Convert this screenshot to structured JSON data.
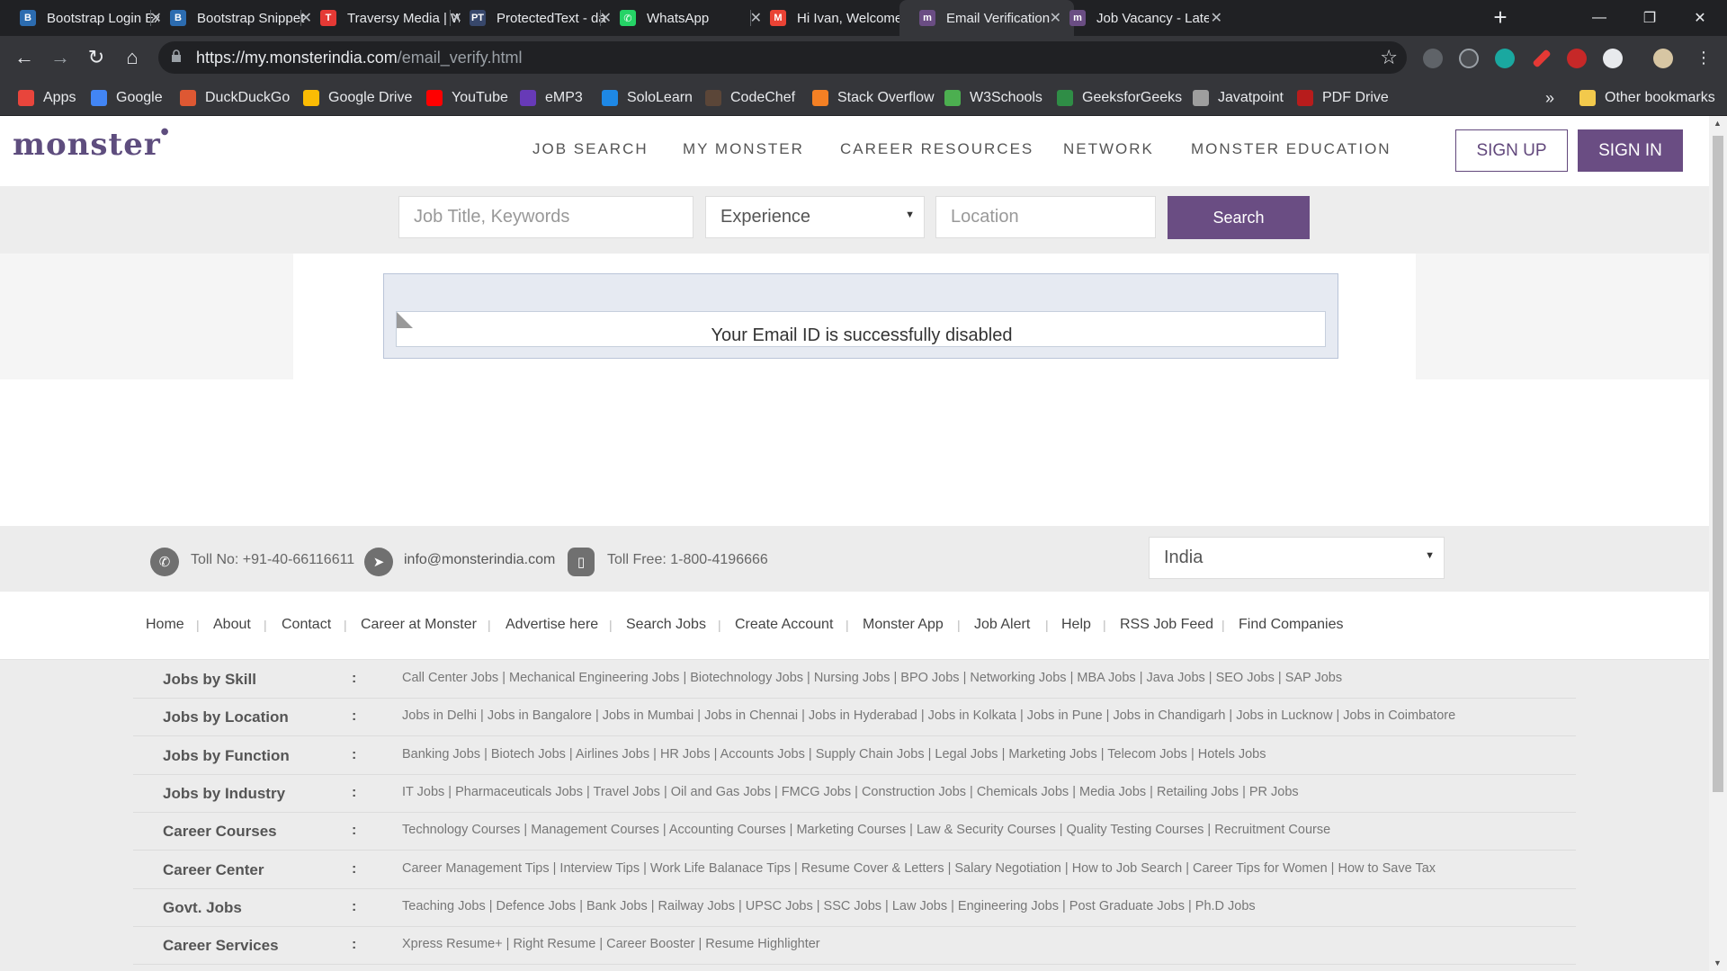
{
  "browser": {
    "tabs": [
      {
        "label": "Bootstrap Login Ex",
        "icon": "bootstrap-icon",
        "color": "#2c6cb0",
        "glyph": "B"
      },
      {
        "label": "Bootstrap Snippet",
        "icon": "bootstrap-icon",
        "color": "#2c6cb0",
        "glyph": "B"
      },
      {
        "label": "Traversy Media | W",
        "icon": "traversy-icon",
        "color": "#e53935",
        "glyph": "T"
      },
      {
        "label": "ProtectedText - da",
        "icon": "protectedtext-icon",
        "color": "#37476b",
        "glyph": "PT"
      },
      {
        "label": "WhatsApp",
        "icon": "whatsapp-icon",
        "color": "#25d366",
        "glyph": "✆"
      },
      {
        "label": "Hi Ivan, Welcome t",
        "icon": "gmail-icon",
        "color": "#ea4335",
        "glyph": "M"
      },
      {
        "label": "Email Verification",
        "icon": "monster-icon",
        "color": "#6a4d83",
        "glyph": "m"
      },
      {
        "label": "Job Vacancy - Late",
        "icon": "monster-icon",
        "color": "#6a4d83",
        "glyph": "m"
      }
    ],
    "active_tab_index": 6,
    "url_base": "https://my.monsterindia.com",
    "url_path": "/email_verify.html",
    "bookmarks": [
      {
        "label": "Apps",
        "icon": "apps-grid-icon",
        "color": "#e8453c"
      },
      {
        "label": "Google",
        "icon": "google-icon",
        "color": "#4285f4"
      },
      {
        "label": "DuckDuckGo",
        "icon": "duckduckgo-icon",
        "color": "#de5833"
      },
      {
        "label": "Google Drive",
        "icon": "google-drive-icon",
        "color": "#fbbc04"
      },
      {
        "label": "YouTube",
        "icon": "youtube-icon",
        "color": "#ff0000"
      },
      {
        "label": "eMP3",
        "icon": "emp3-icon",
        "color": "#673ab7"
      },
      {
        "label": "SoloLearn",
        "icon": "sololearn-icon",
        "color": "#1e88e5"
      },
      {
        "label": "CodeChef",
        "icon": "codechef-icon",
        "color": "#5b4638"
      },
      {
        "label": "Stack Overflow",
        "icon": "stackoverflow-icon",
        "color": "#f48024"
      },
      {
        "label": "W3Schools",
        "icon": "w3schools-icon",
        "color": "#4caf50"
      },
      {
        "label": "GeeksforGeeks",
        "icon": "geeksforgeeks-icon",
        "color": "#2f8d46"
      },
      {
        "label": "Javatpoint",
        "icon": "javatpoint-icon",
        "color": "#9e9e9e"
      },
      {
        "label": "PDF Drive",
        "icon": "pdfdrive-icon",
        "color": "#b71c1c"
      }
    ],
    "bookmarks_overflow": "»",
    "other_bookmarks": "Other bookmarks"
  },
  "site": {
    "logo": "monster",
    "nav": [
      "JOB SEARCH",
      "MY MONSTER",
      "CAREER RESOURCES",
      "NETWORK",
      "MONSTER EDUCATION"
    ],
    "signup": "SIGN UP",
    "signin": "SIGN IN",
    "brand_color": "#6a4d83"
  },
  "search": {
    "keywords_placeholder": "Job Title, Keywords",
    "experience_value": "Experience",
    "location_placeholder": "Location",
    "button": "Search"
  },
  "message": {
    "text": "Your Email ID is successfully disabled"
  },
  "contact": {
    "toll_no": "Toll No: +91-40-66116611",
    "email": "info@monsterindia.com",
    "toll_free": "Toll Free: 1-800-4196666",
    "country": "India"
  },
  "footer_links": [
    "Home",
    "About",
    "Contact",
    "Career at Monster",
    "Advertise here",
    "Search Jobs",
    "Create Account",
    "Monster App",
    "Job Alert",
    "Help",
    "RSS Job Feed",
    "Find Companies"
  ],
  "seo_rows": [
    {
      "head": "Jobs by Skill",
      "links": "Call Center Jobs | Mechanical Engineering Jobs | Biotechnology Jobs | Nursing Jobs | BPO Jobs | Networking Jobs | MBA Jobs | Java Jobs | SEO Jobs | SAP Jobs"
    },
    {
      "head": "Jobs by Location",
      "links": "Jobs in Delhi | Jobs in Bangalore | Jobs in Mumbai | Jobs in Chennai | Jobs in Hyderabad | Jobs in Kolkata | Jobs in Pune | Jobs in Chandigarh | Jobs in Lucknow | Jobs in Coimbatore"
    },
    {
      "head": "Jobs by Function",
      "links": "Banking Jobs | Biotech Jobs | Airlines Jobs | HR Jobs | Accounts Jobs | Supply Chain Jobs | Legal Jobs | Marketing Jobs | Telecom Jobs | Hotels Jobs"
    },
    {
      "head": "Jobs by Industry",
      "links": "IT Jobs | Pharmaceuticals Jobs | Travel Jobs | Oil and Gas Jobs | FMCG Jobs | Construction Jobs | Chemicals Jobs | Media Jobs | Retailing Jobs | PR Jobs"
    },
    {
      "head": "Career Courses",
      "links": "Technology Courses | Management Courses | Accounting Courses | Marketing Courses | Law & Security Courses | Quality Testing Courses | Recruitment Course"
    },
    {
      "head": "Career Center",
      "links": "Career Management Tips | Interview Tips | Work Life Balanace Tips | Resume Cover & Letters | Salary Negotiation | How to Job Search | Career Tips for Women | How to Save Tax"
    },
    {
      "head": "Govt. Jobs",
      "links": "Teaching Jobs | Defence Jobs | Bank Jobs | Railway Jobs | UPSC Jobs | SSC Jobs | Law Jobs | Engineering Jobs | Post Graduate Jobs | Ph.D Jobs"
    },
    {
      "head": "Career Services",
      "links": "Xpress Resume+ | Right Resume | Career Booster | Resume Highlighter"
    }
  ],
  "seo_colon": ":"
}
